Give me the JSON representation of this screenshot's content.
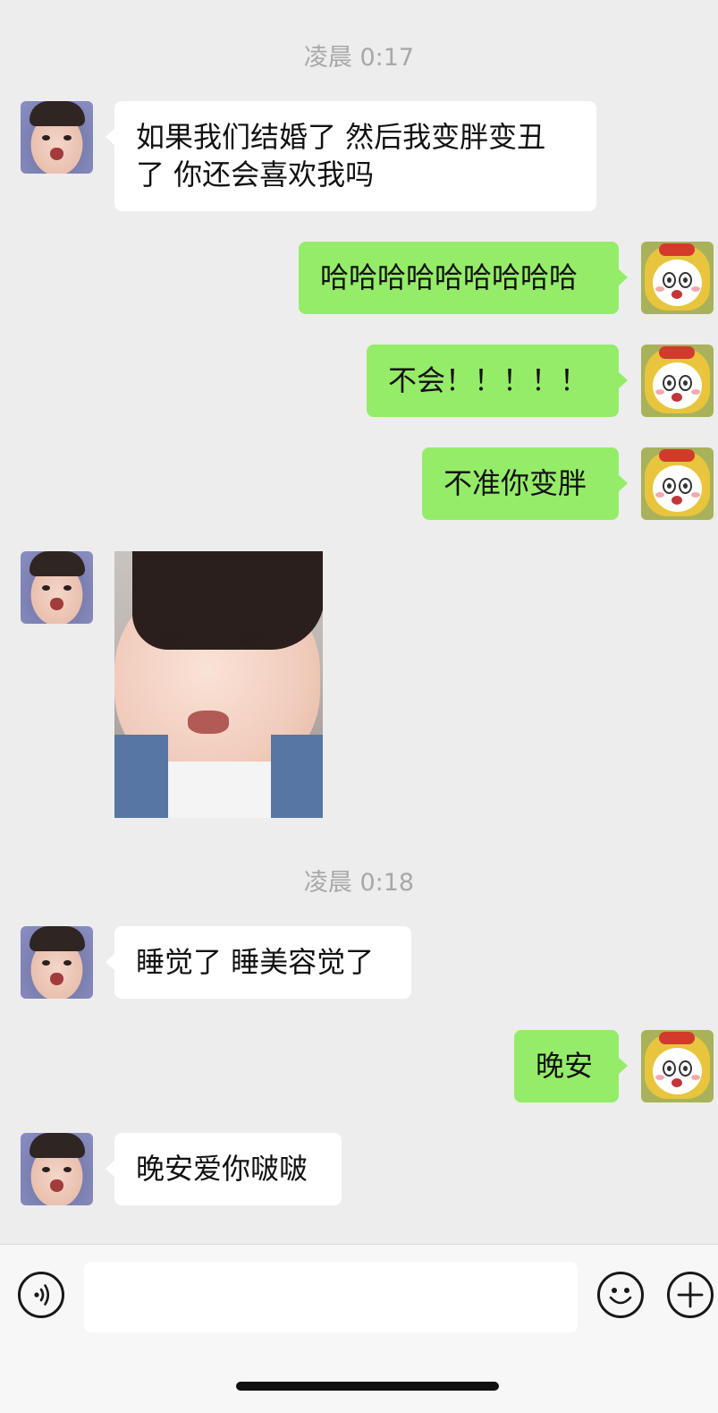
{
  "chat": {
    "timestamps": [
      "凌晨 0:17",
      "凌晨 0:18"
    ],
    "messages": [
      {
        "side": "left",
        "type": "text",
        "text": "如果我们结婚了 然后我变胖变丑\n了 你还会喜欢我吗"
      },
      {
        "side": "right",
        "type": "text",
        "text": "哈哈哈哈哈哈哈哈哈"
      },
      {
        "side": "right",
        "type": "text",
        "text": "不会！！！！！"
      },
      {
        "side": "right",
        "type": "text",
        "text": "不准你变胖"
      },
      {
        "side": "left",
        "type": "image",
        "text": ""
      },
      {
        "side": "left",
        "type": "text",
        "text": "睡觉了 睡美容觉了"
      },
      {
        "side": "right",
        "type": "text",
        "text": "晚安"
      },
      {
        "side": "left",
        "type": "text",
        "text": "晚安爱你啵啵"
      }
    ]
  },
  "input_bar": {
    "text_value": "",
    "icons": [
      "voice-icon",
      "emoji-icon",
      "plus-icon"
    ]
  },
  "colors": {
    "background": "#ededed",
    "bubble_self": "#95ec69",
    "bubble_other": "#ffffff",
    "timestamp": "#a8a8a8"
  }
}
